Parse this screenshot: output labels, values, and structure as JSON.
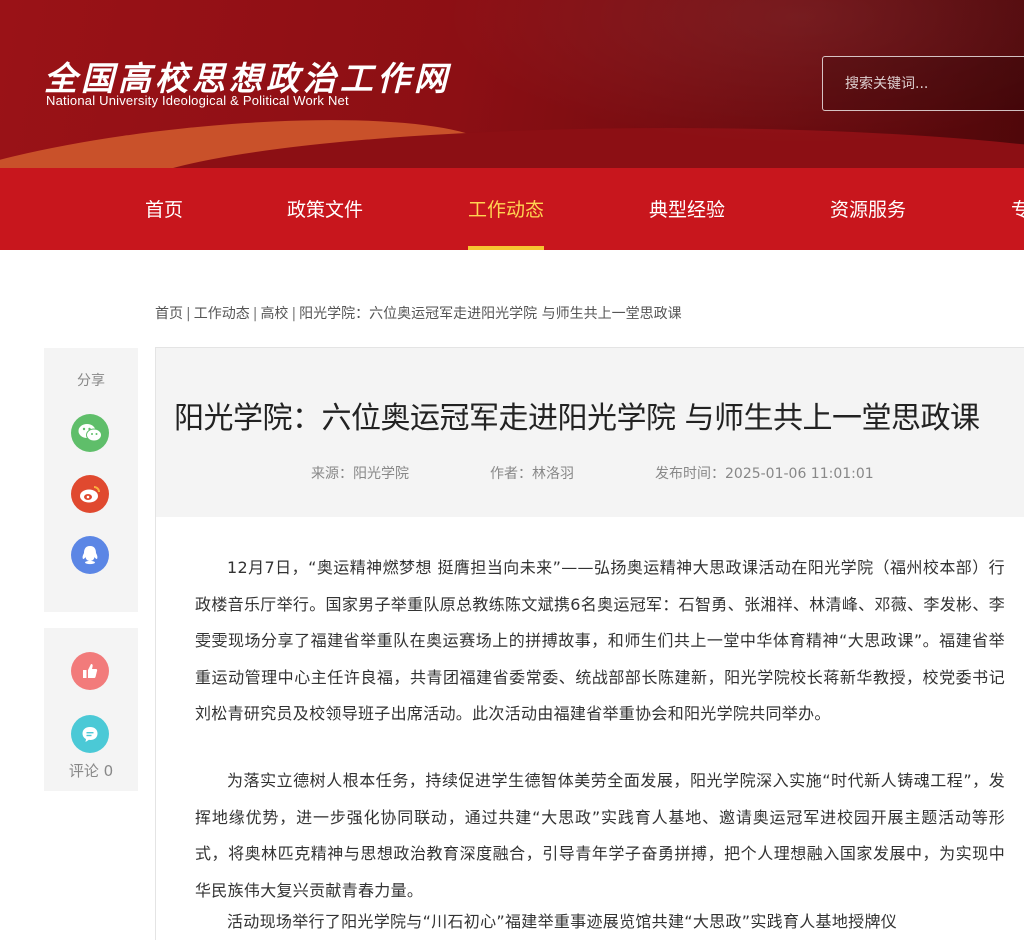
{
  "header": {
    "logo_cn": "全国高校思想政治工作网",
    "logo_en": "National University Ideological & Political Work Net",
    "search_placeholder": "搜索关键词..."
  },
  "nav": {
    "items": [
      "首页",
      "政策文件",
      "工作动态",
      "典型经验",
      "资源服务",
      "专"
    ],
    "active_index": 2,
    "active_color": "#ffd452",
    "bar_color": "#c8161d"
  },
  "breadcrumb": [
    "首页",
    "工作动态",
    "高校",
    "阳光学院：六位奥运冠军走进阳光学院 与师生共上一堂思政课"
  ],
  "share": {
    "label": "分享",
    "icons": [
      "wechat-icon",
      "weibo-icon",
      "qq-icon"
    ],
    "like_icon": "thumbs-up-icon",
    "comment_icon": "comment-icon",
    "comment_label": "评论 0"
  },
  "article": {
    "title": "阳光学院：六位奥运冠军走进阳光学院 与师生共上一堂思政课",
    "source": "来源：阳光学院",
    "author": "作者：林洛羽",
    "published": "发布时间：2025-01-06 11:01:01",
    "paragraphs": [
      "12月7日，“奥运精神燃梦想 挺膺担当向未来”——弘扬奥运精神大思政课活动在阳光学院（福州校本部）行政楼音乐厅举行。国家男子举重队原总教练陈文斌携6名奥运冠军：石智勇、张湘祥、林清峰、邓薇、李发彬、李雯雯现场分享了福建省举重队在奥运赛场上的拼搏故事，和师生们共上一堂中华体育精神“大思政课”。福建省举重运动管理中心主任许良福，共青团福建省委常委、统战部部长陈建新，阳光学院校长蒋新华教授，校党委书记刘松青研究员及校领导班子出席活动。此次活动由福建省举重协会和阳光学院共同举办。",
      "为落实立德树人根本任务，持续促进学生德智体美劳全面发展，阳光学院深入实施“时代新人铸魂工程”，发挥地缘优势，进一步强化协同联动，通过共建“大思政”实践育人基地、邀请奥运冠军进校园开展主题活动等形式，将奥林匹克精神与思想政治教育深度融合，引导青年学子奋勇拼搏，把个人理想融入国家发展中，为实现中华民族伟大复兴贡献青春力量。",
      "活动现场举行了阳光学院与“川石初心”福建举重事迹展览馆共建“大思政”实践育人基地授牌仪"
    ]
  }
}
